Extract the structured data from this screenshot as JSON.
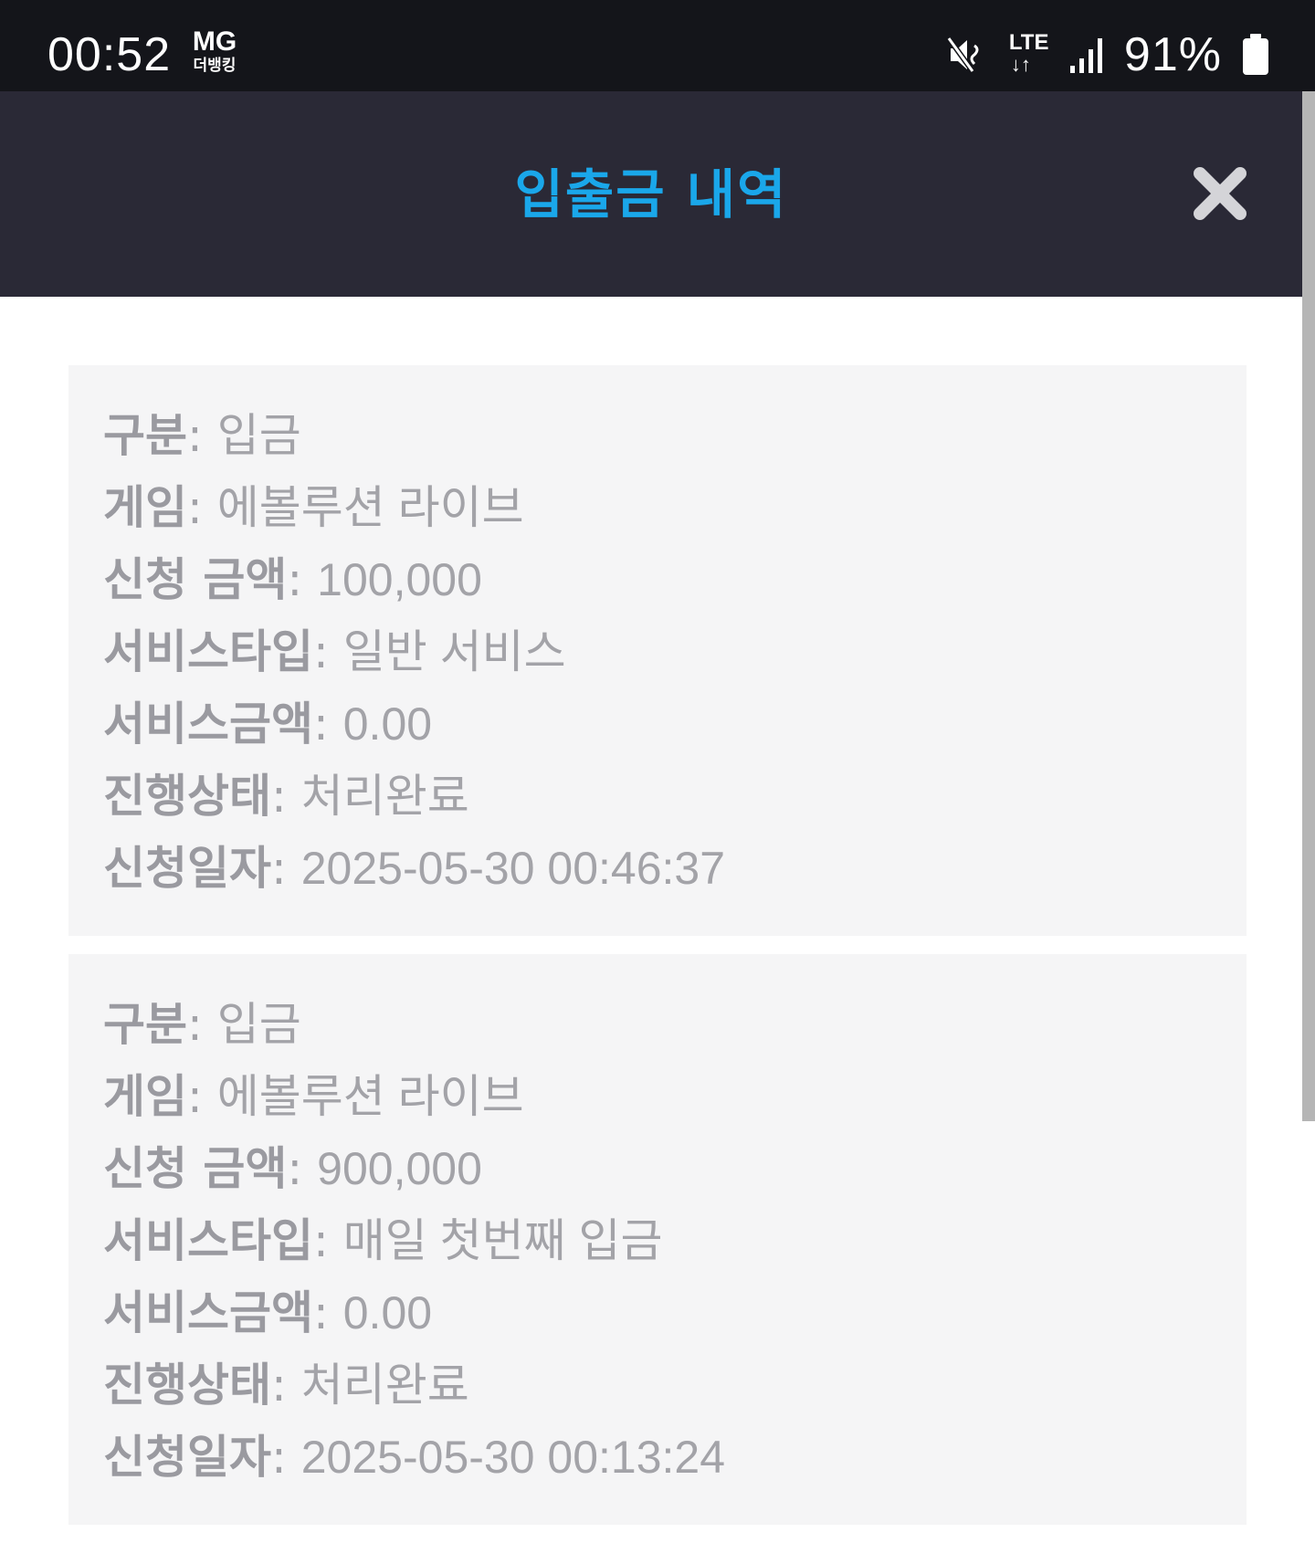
{
  "status_bar": {
    "time": "00:52",
    "carrier_top": "MG",
    "carrier_bottom": "더뱅킹",
    "network": "LTE",
    "network_arrows": "↓↑",
    "battery": "91%",
    "icons": [
      "mute-icon",
      "signal-icon",
      "battery-icon"
    ]
  },
  "header": {
    "title": "입출금 내역",
    "close_icon": "close-icon",
    "title_color": "#1aa7ea",
    "background": "#2a2936"
  },
  "records": [
    {
      "type_label": "구분",
      "type_value": "입금",
      "game_label": "게임",
      "game_value": "에볼루션 라이브",
      "amount_label": "신청 금액",
      "amount_value": "100,000",
      "service_type_label": "서비스타입",
      "service_type_value": "일반 서비스",
      "service_amount_label": "서비스금액",
      "service_amount_value": "0.00",
      "status_label": "진행상태",
      "status_value": "처리완료",
      "date_label": "신청일자",
      "date_value": "2025-05-30 00:46:37"
    },
    {
      "type_label": "구분",
      "type_value": "입금",
      "game_label": "게임",
      "game_value": "에볼루션 라이브",
      "amount_label": "신청 금액",
      "amount_value": "900,000",
      "service_type_label": "서비스타입",
      "service_type_value": "매일 첫번째 입금",
      "service_amount_label": "서비스금액",
      "service_amount_value": "0.00",
      "status_label": "진행상태",
      "status_value": "처리완료",
      "date_label": "신청일자",
      "date_value": "2025-05-30 00:13:24"
    }
  ]
}
